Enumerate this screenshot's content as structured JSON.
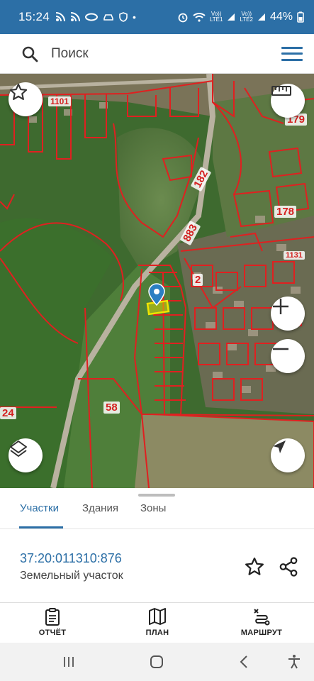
{
  "status_bar": {
    "time": "15:24",
    "network_1": "Vo))\nLTE1",
    "network_2": "Vo))\nLTE2",
    "battery": "44%"
  },
  "search": {
    "placeholder": "Поиск"
  },
  "map": {
    "labels": [
      "1101",
      "179",
      "182",
      "178",
      "883",
      "1131",
      "2",
      "24",
      "58"
    ]
  },
  "tabs": {
    "items": [
      "Участки",
      "Здания",
      "Зоны"
    ],
    "active": "Участки"
  },
  "parcel": {
    "number": "37:20:011310:876",
    "type": "Земельный участок"
  },
  "bottom_nav": {
    "report": "ОТЧЁТ",
    "plan": "ПЛАН",
    "route": "МАРШРУТ"
  },
  "colors": {
    "accent": "#2c6fa6",
    "parcel_border": "#e02020",
    "selected_parcel": "#f0e400"
  }
}
